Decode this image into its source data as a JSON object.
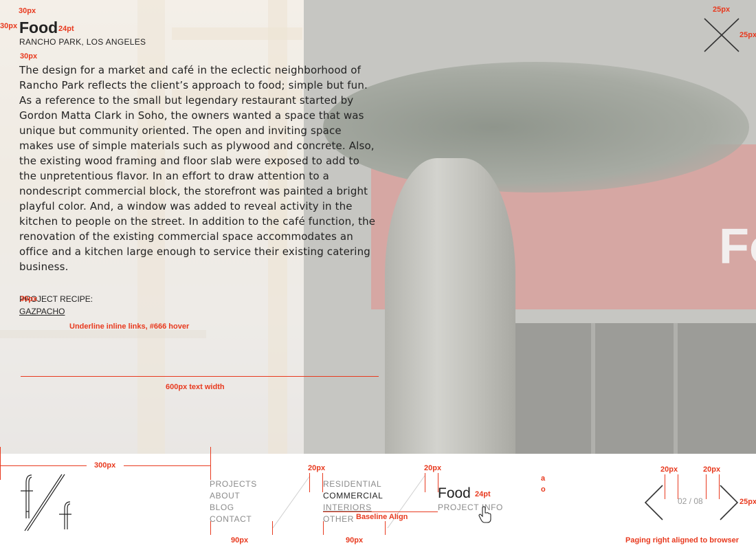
{
  "project": {
    "title": "Food",
    "location": "RANCHO PARK, LOS ANGELES",
    "description": "The design for a market and café in the eclectic neighborhood of Rancho Park reflects the client’s approach to food; simple but fun. As a reference to the small but legendary restaurant started by Gordon Matta Clark in Soho, the owners wanted a space that was unique but community oriented. The open and inviting space makes use of simple materials such as plywood and concrete. Also, the existing wood framing and floor slab were exposed to add to the unpretentious flavor. In an effort to draw attention to a nondescript commercial block, the storefront was painted a bright playful color. And, a window was added to reveal activity in the kitchen to people on the street. In addition to the café function, the renovation of the existing commercial space accommodates an office and a kitchen large enough to service their existing catering business.",
    "recipe_label": "PROJECT RECIPE:",
    "recipe_link": "GAZPACHO"
  },
  "hero": {
    "sign_text": "Fo"
  },
  "nav": {
    "main": [
      "PROJECTS",
      "ABOUT",
      "BLOG",
      "CONTACT"
    ],
    "sub": [
      {
        "label": "RESIDENTIAL",
        "state": "muted"
      },
      {
        "label": "COMMERCIAL",
        "state": "active"
      },
      {
        "label": "INTERIORS",
        "state": "underlined"
      },
      {
        "label": "OTHER",
        "state": "muted"
      }
    ]
  },
  "footer": {
    "project_title": "Food",
    "project_info": "PROJECT INFO",
    "pager": "02 / 08"
  },
  "annotations": {
    "a_top1": "30px",
    "a_top2": "30px",
    "a_title": "24pt",
    "a_loc": "30px",
    "a_body": "30px",
    "a_link": "Underline inline links, #666 hover",
    "a_width": "600px text width",
    "a_close1": "25px",
    "a_close2": "25px",
    "a_300": "300px",
    "a_20a": "20px",
    "a_20b": "20px",
    "a_90a": "90px",
    "a_90b": "90px",
    "a_baseline": "Baseline Align",
    "a_24pt": "24pt",
    "a_frag1": "a",
    "a_frag2": "o",
    "a_p20a": "20px",
    "a_p20b": "20px",
    "a_p25": "25px",
    "a_paging": "Paging right aligned to browser"
  },
  "colors": {
    "accent": "#e8391e",
    "hover": "#666666",
    "muted": "#8a8a8a",
    "text": "#222222"
  },
  "icons": [
    "close-icon",
    "logo-ff",
    "chevron-left-icon",
    "chevron-right-icon",
    "hand-cursor-icon"
  ]
}
